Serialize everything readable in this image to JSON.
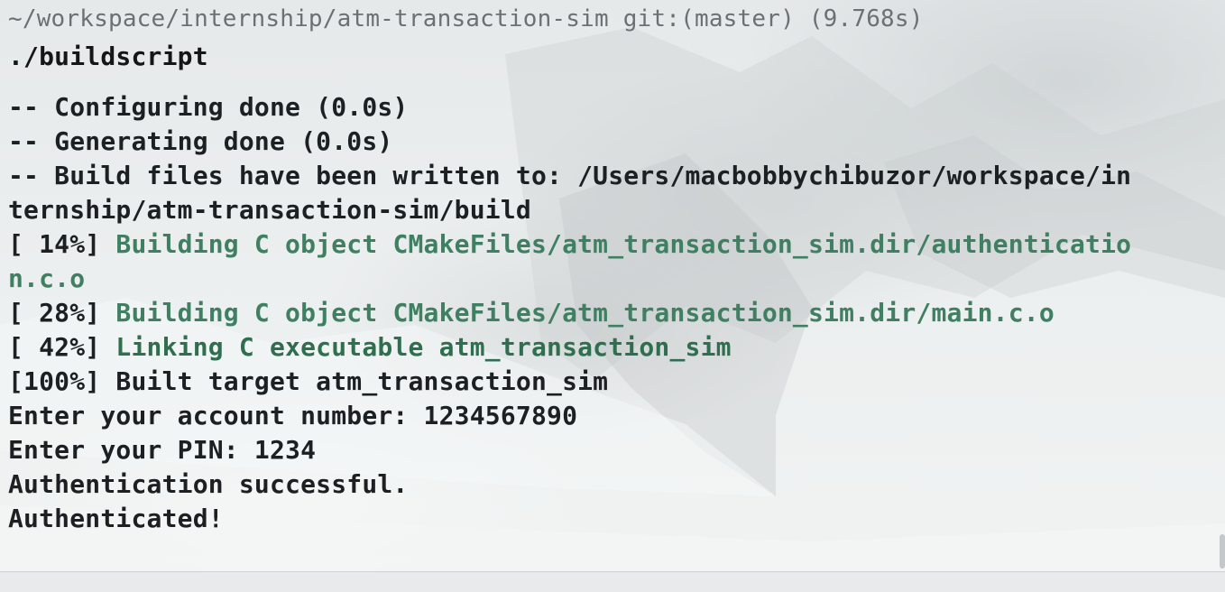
{
  "terminal": {
    "prompt": "~/workspace/internship/atm-transaction-sim git:(master) (9.768s)",
    "command": "./buildscript",
    "output": [
      {
        "text": "-- Configuring done (0.0s)"
      },
      {
        "text": "-- Generating done (0.0s)"
      },
      {
        "text": "-- Build files have been written to: /Users/macbobbychibuzor/workspace/in"
      },
      {
        "text": "ternship/atm-transaction-sim/build"
      },
      {
        "prefix": "[ 14%] ",
        "text": "Building C object CMakeFiles/atm_transaction_sim.dir/authenticatio"
      },
      {
        "text": "n.c.o"
      },
      {
        "prefix": "[ 28%] ",
        "text": "Building C object CMakeFiles/atm_transaction_sim.dir/main.c.o"
      },
      {
        "prefix": "[ 42%] ",
        "text": "Linking C executable atm_transaction_sim"
      },
      {
        "text": "[100%] Built target atm_transaction_sim"
      },
      {
        "text": "Enter your account number: 1234567890"
      },
      {
        "text": "Enter your PIN: 1234"
      },
      {
        "text": "Authentication successful."
      },
      {
        "text": "Authenticated!"
      }
    ]
  },
  "colors": {
    "prompt_gray": "#6d7073",
    "text": "#1d2022",
    "cmake_green": "#3f7f62"
  }
}
